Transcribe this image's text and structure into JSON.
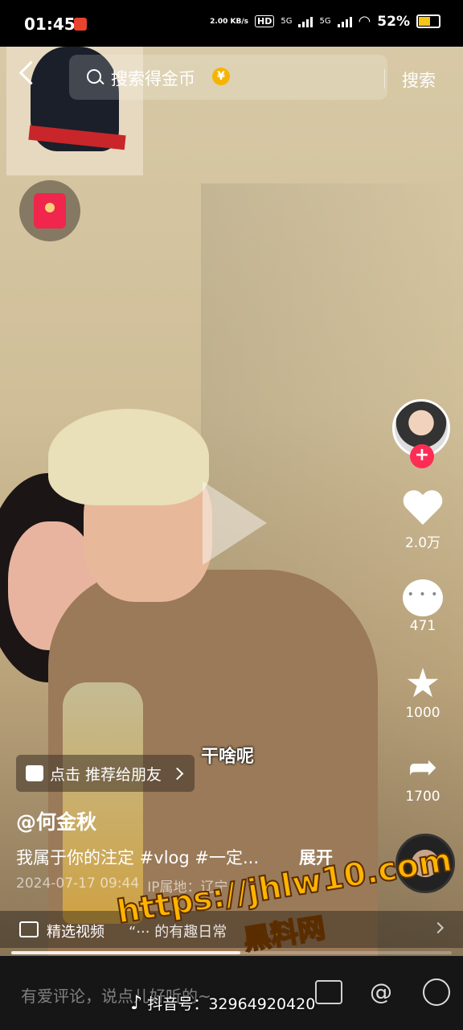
{
  "status_bar": {
    "time": "01:45",
    "net_speed": "2.00 KB/s",
    "hd": "HD",
    "sim1": "5G",
    "sim2": "5G",
    "battery": "52%"
  },
  "search": {
    "placeholder": "搜索得金币",
    "coin_glyph": "¥",
    "button": "搜索"
  },
  "actions": {
    "likes": "2.0万",
    "comments": "471",
    "favorites": "1000",
    "shares": "1700",
    "follow_glyph": "+"
  },
  "video": {
    "subtitle": "干啥呢",
    "recommend": "点击 推荐给朋友",
    "author": "@何金秋",
    "caption": "我属于你的注定 #vlog #一定...",
    "expand": "展开",
    "date": "2024-07-17 09:44",
    "ip_location": "IP属地：辽宁",
    "progress": 0.52
  },
  "collection": {
    "label": "精选视频",
    "title": "“··· 的有趣日常"
  },
  "comment_bar": {
    "placeholder": "有爱评论，说点儿好听的~",
    "at_glyph": "@"
  },
  "watermark": {
    "url": "https://jhlw10.com",
    "name": "黑料网",
    "tiktok_label": "抖音号：32964920420"
  },
  "colors": {
    "accent": "#fe2c55",
    "coin": "#f5b400",
    "watermark": "#ffb400"
  }
}
